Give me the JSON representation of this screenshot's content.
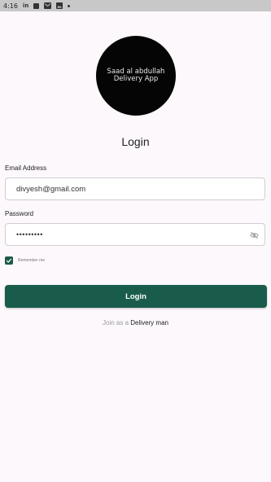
{
  "status_bar": {
    "time": "4:16",
    "icons": [
      "linkedin-icon",
      "app-square-icon",
      "mail-icon",
      "image-icon",
      "dot-icon"
    ]
  },
  "logo": {
    "line1": "Saad al abdullah",
    "line2": "Delivery App"
  },
  "title": "Login",
  "email": {
    "label": "Email Address",
    "value": "divyesh@gmail.com"
  },
  "password": {
    "label": "Password",
    "value": "•••••••••",
    "toggle_icon": "eye-off-icon"
  },
  "remember": {
    "label": "Remember me",
    "checked": true
  },
  "login_button": "Login",
  "join": {
    "prefix": "Join as a",
    "link": "Delivery man"
  },
  "colors": {
    "primary": "#1a5c4b",
    "background": "#fcf8fc",
    "status_bar": "#c8c8c8",
    "logo_bg": "#050505"
  }
}
